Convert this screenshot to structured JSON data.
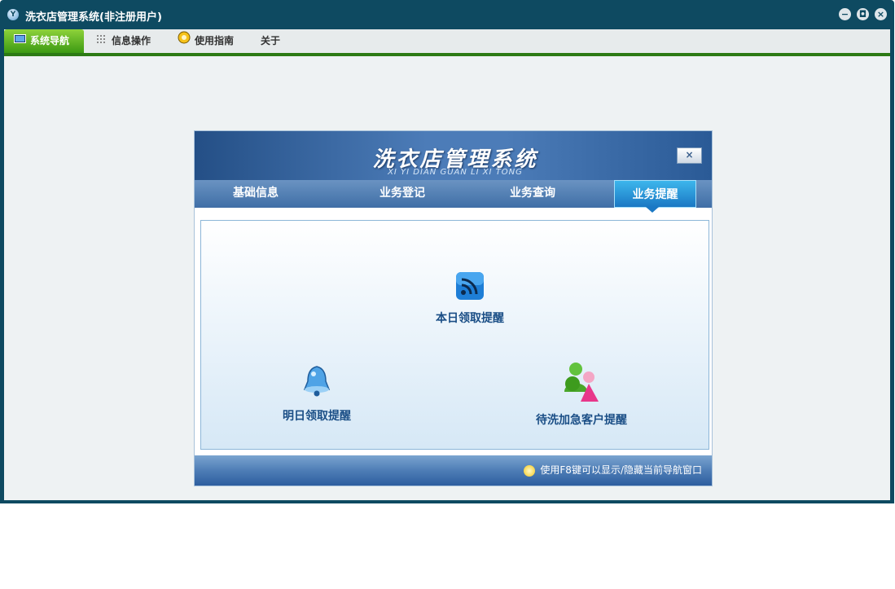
{
  "window": {
    "title": "洗衣店管理系统(非注册用户)",
    "logo_text": "Y",
    "controls": {
      "minimize": "−",
      "restore": "◘",
      "close": "×"
    }
  },
  "menu": [
    {
      "label": "系统导航",
      "icon": "monitor-icon"
    },
    {
      "label": "信息操作",
      "icon": "grid-icon"
    },
    {
      "label": "使用指南",
      "icon": "help-icon"
    },
    {
      "label": "关于",
      "icon": ""
    }
  ],
  "panel": {
    "title": "洗衣店管理系统",
    "subtitle": "XI YI DIAN GUAN LI XI TONG",
    "close": "×",
    "tabs": [
      "基础信息",
      "业务登记",
      "业务查询",
      "业务提醒"
    ],
    "active_tab": "业务提醒",
    "actions": [
      {
        "label": "本日领取提醒",
        "icon": "rss-icon"
      },
      {
        "label": "明日领取提醒",
        "icon": "bell-icon"
      },
      {
        "label": "待洗加急客户提醒",
        "icon": "customers-icon"
      }
    ],
    "footer_hint": "使用F8键可以显示/隐藏当前导航窗口"
  },
  "colors": {
    "frame": "#0e4a61",
    "menu_accent": "#2c7a14",
    "tab_active": "#1a78c4",
    "text_blue": "#1a4e86"
  }
}
